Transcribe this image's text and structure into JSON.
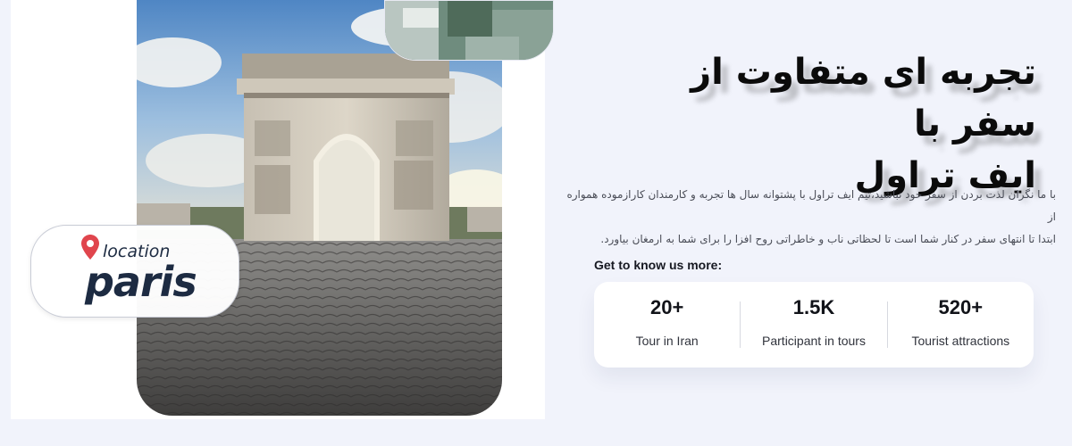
{
  "hero": {
    "title_line1": "تجربه ای متفاوت از سفر با",
    "title_line2": "ایف تراول",
    "description_line1": "با ما نگران لذت بردن از سفر خود نباشید،تیم ایف تراول با پشتوانه سال ها تجربه و کارمندان کارازموده همواره از",
    "description_line2": "ابتدا تا انتهای سفر در کنار شما است تا لحظاتی ناب و خاطراتی روح افزا را برای شما به ارمغان بیاورد."
  },
  "location_card": {
    "label": "location",
    "city": "paris",
    "icon": "map-pin-icon",
    "pin_color": "#e0454d"
  },
  "stats": {
    "heading": "Get to know us more:",
    "items": [
      {
        "value": "20+",
        "label": "Tour in Iran"
      },
      {
        "value": "1.5K",
        "label": "Participant in tours"
      },
      {
        "value": "520+",
        "label": "Tourist attractions"
      }
    ]
  },
  "colors": {
    "page_background": "#f1f3fb",
    "text_dark": "#1d2b42"
  }
}
